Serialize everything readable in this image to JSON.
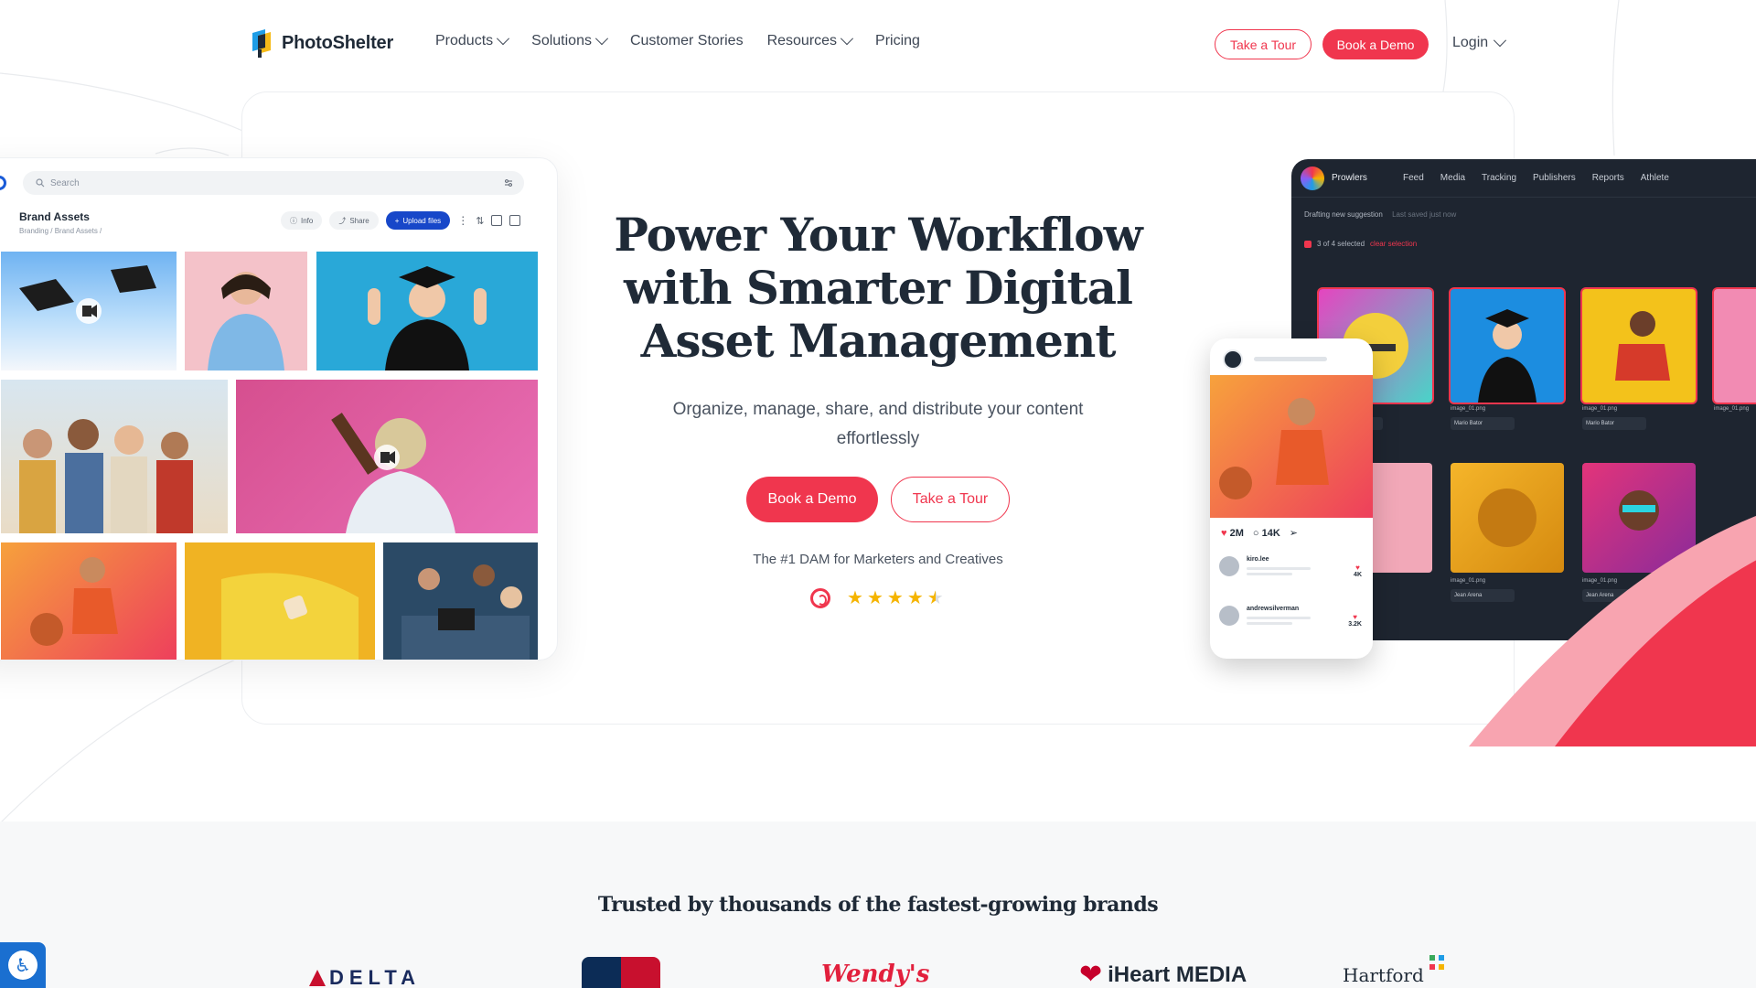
{
  "brand": {
    "name": "PhotoShelter"
  },
  "nav": {
    "items": [
      {
        "label": "Products",
        "has_dropdown": true
      },
      {
        "label": "Solutions",
        "has_dropdown": true
      },
      {
        "label": "Customer Stories",
        "has_dropdown": false
      },
      {
        "label": "Resources",
        "has_dropdown": true
      },
      {
        "label": "Pricing",
        "has_dropdown": false
      }
    ],
    "tour_label": "Take a Tour",
    "demo_label": "Book a Demo",
    "login_label": "Login"
  },
  "hero": {
    "title": "Power Your Workflow with Smarter Digital Asset Management",
    "subtitle": "Organize, manage, share, and distribute your content effortlessly",
    "demo_label": "Book a Demo",
    "tour_label": "Take a Tour",
    "tagline": "The #1 DAM for Marketers and Creatives",
    "rating_stars": 4.5
  },
  "left_app": {
    "search_placeholder": "Search",
    "title": "Brand Assets",
    "breadcrumb": "Branding / Brand Assets /",
    "info_label": "Info",
    "share_label": "Share",
    "upload_label": "Upload files"
  },
  "right_app": {
    "brand": "Prowlers",
    "tabs": [
      "Feed",
      "Media",
      "Tracking",
      "Publishers",
      "Reports",
      "Athlete"
    ],
    "draft_label": "Drafting new suggestion",
    "draft_status": "Last saved just now",
    "selection_label": "3 of 4 selected",
    "clear_label": "clear selection",
    "file_label": "image_01.png",
    "chips": [
      "Mario Bator",
      "Mario Bator",
      "Jean Arena",
      "Jean Arena"
    ]
  },
  "phone": {
    "likes": "2M",
    "comments": "14K",
    "comment_1": {
      "user": "kiro.lee",
      "count": "4K"
    },
    "comment_2": {
      "user": "andrewsilverman",
      "count": "3.2K"
    }
  },
  "trust": {
    "title": "Trusted by thousands of the fastest-growing brands",
    "logos": [
      "DELTA",
      "MLB",
      "Wendy's",
      "iHeart MEDIA",
      "Hartford"
    ]
  },
  "colors": {
    "accent": "#f0364e",
    "text": "#1f2a37",
    "app_dark": "#1e2530",
    "primary_blue": "#1747c9"
  }
}
